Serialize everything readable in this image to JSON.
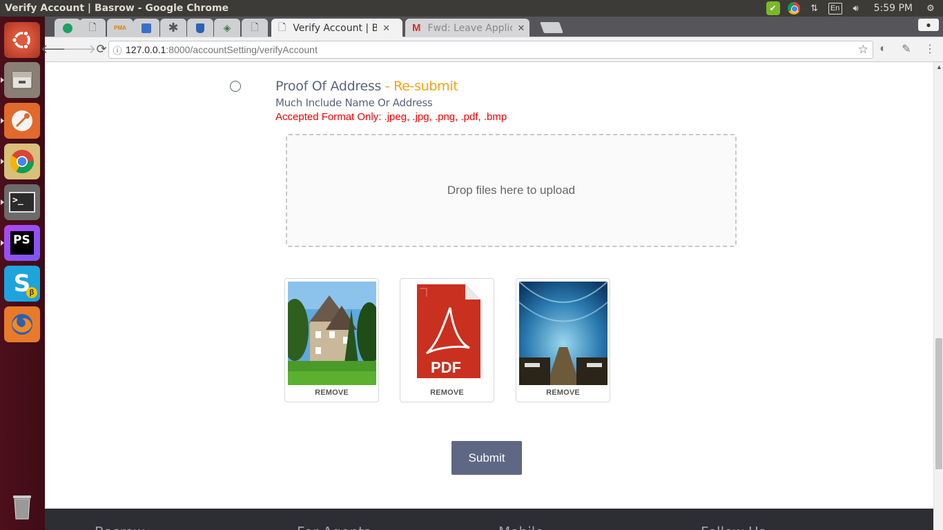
{
  "os": {
    "window_title": "Verify Account | Basrow - Google Chrome",
    "keyboard_layout": "En",
    "time": "5:59 PM"
  },
  "launcher": {
    "apps": [
      "ubuntu-dash",
      "files",
      "postman",
      "chrome",
      "terminal",
      "phpstorm",
      "skype-beta",
      "firefox",
      "trash"
    ]
  },
  "browser": {
    "tabs": [
      {
        "icon": "sheets-icon",
        "pinned": true
      },
      {
        "icon": "page-icon",
        "pinned": true
      },
      {
        "icon": "phpmyadmin-icon",
        "pinned": true,
        "label": "PMA"
      },
      {
        "icon": "database-icon",
        "pinned": true
      },
      {
        "icon": "asterisk-icon",
        "pinned": true
      },
      {
        "icon": "bucket-icon",
        "pinned": true
      },
      {
        "icon": "diamond-icon",
        "pinned": true
      },
      {
        "icon": "page-icon",
        "pinned": true
      },
      {
        "title": "Verify Account | Basrow",
        "active": true
      },
      {
        "title": "Fwd: Leave Application",
        "icon": "gmail-icon"
      }
    ],
    "url_host": "127.0.0.1",
    "url_rest": ":8000/accountSetting/verifyAccount"
  },
  "page": {
    "doc_title": "Proof Of Address",
    "doc_status": " - Re-submit",
    "doc_subtitle": "Much Include Name Or Address",
    "doc_formats": "Accepted Format Only: .jpeg, .jpg, .png, .pdf, .bmp",
    "dropzone_text": "Drop files here to upload",
    "previews": [
      {
        "type": "image",
        "subject": "house-photo",
        "remove_label": "REMOVE"
      },
      {
        "type": "pdf",
        "subject": "pdf-file-icon",
        "label": "PDF",
        "remove_label": "REMOVE"
      },
      {
        "type": "image",
        "subject": "underwater-restaurant-photo",
        "remove_label": "REMOVE"
      }
    ],
    "submit_label": "Submit",
    "footer_headings": [
      "Basrow",
      "For Agents",
      "Mobile",
      "Follow Us"
    ]
  },
  "colors": {
    "accent_status": "#f5a20f",
    "error_text": "#e00000",
    "button_bg": "#5e6884",
    "heading": "#5a6480",
    "footer_bg": "#2c2e33"
  }
}
